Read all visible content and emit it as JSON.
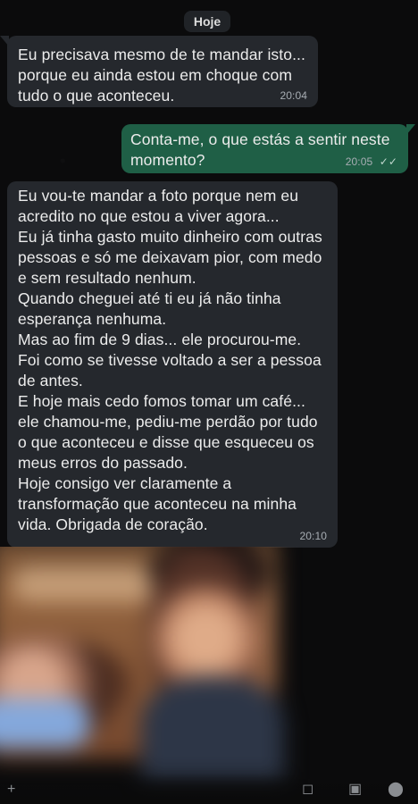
{
  "chat": {
    "date_label": "Hoje",
    "messages": [
      {
        "text": "Eu precisava mesmo de te mandar isto...\nporque eu ainda estou em choque com\ntudo o que aconteceu.",
        "time": "20:04"
      },
      {
        "text": "Conta-me, o que estás a sentir neste\nmomento?",
        "time": "20:05"
      },
      {
        "text": "Eu vou-te mandar a foto porque nem eu\nacredito no que estou a viver agora...\nEu já tinha gasto muito dinheiro com outras\npessoas e só me deixavam pior, com medo\ne sem resultado nenhum.\nQuando cheguei até ti eu já não tinha\nesperança nenhuma.\nMas ao fim de 9 dias... ele procurou-me.\nFoi como se tivesse voltado a ser a pessoa\nde antes.\nE hoje mais cedo fomos tomar um café...\nele chamou-me, pediu-me perdão por tudo\no que aconteceu e disse que esqueceu os\nmeus erros do passado.\nHoje consigo ver claramente a\ntransformação que aconteceu na minha\nvida. Obrigada de coração.",
        "time": "20:10"
      }
    ],
    "read_receipt": "✓✓"
  },
  "icons": {
    "attachment": "+",
    "camera": "◻",
    "video": "▣",
    "microphone": "⬤"
  },
  "colors": {
    "incoming_bubble": "#25282d",
    "outgoing_bubble": "#1f5f46",
    "background": "#0b0b0c"
  }
}
